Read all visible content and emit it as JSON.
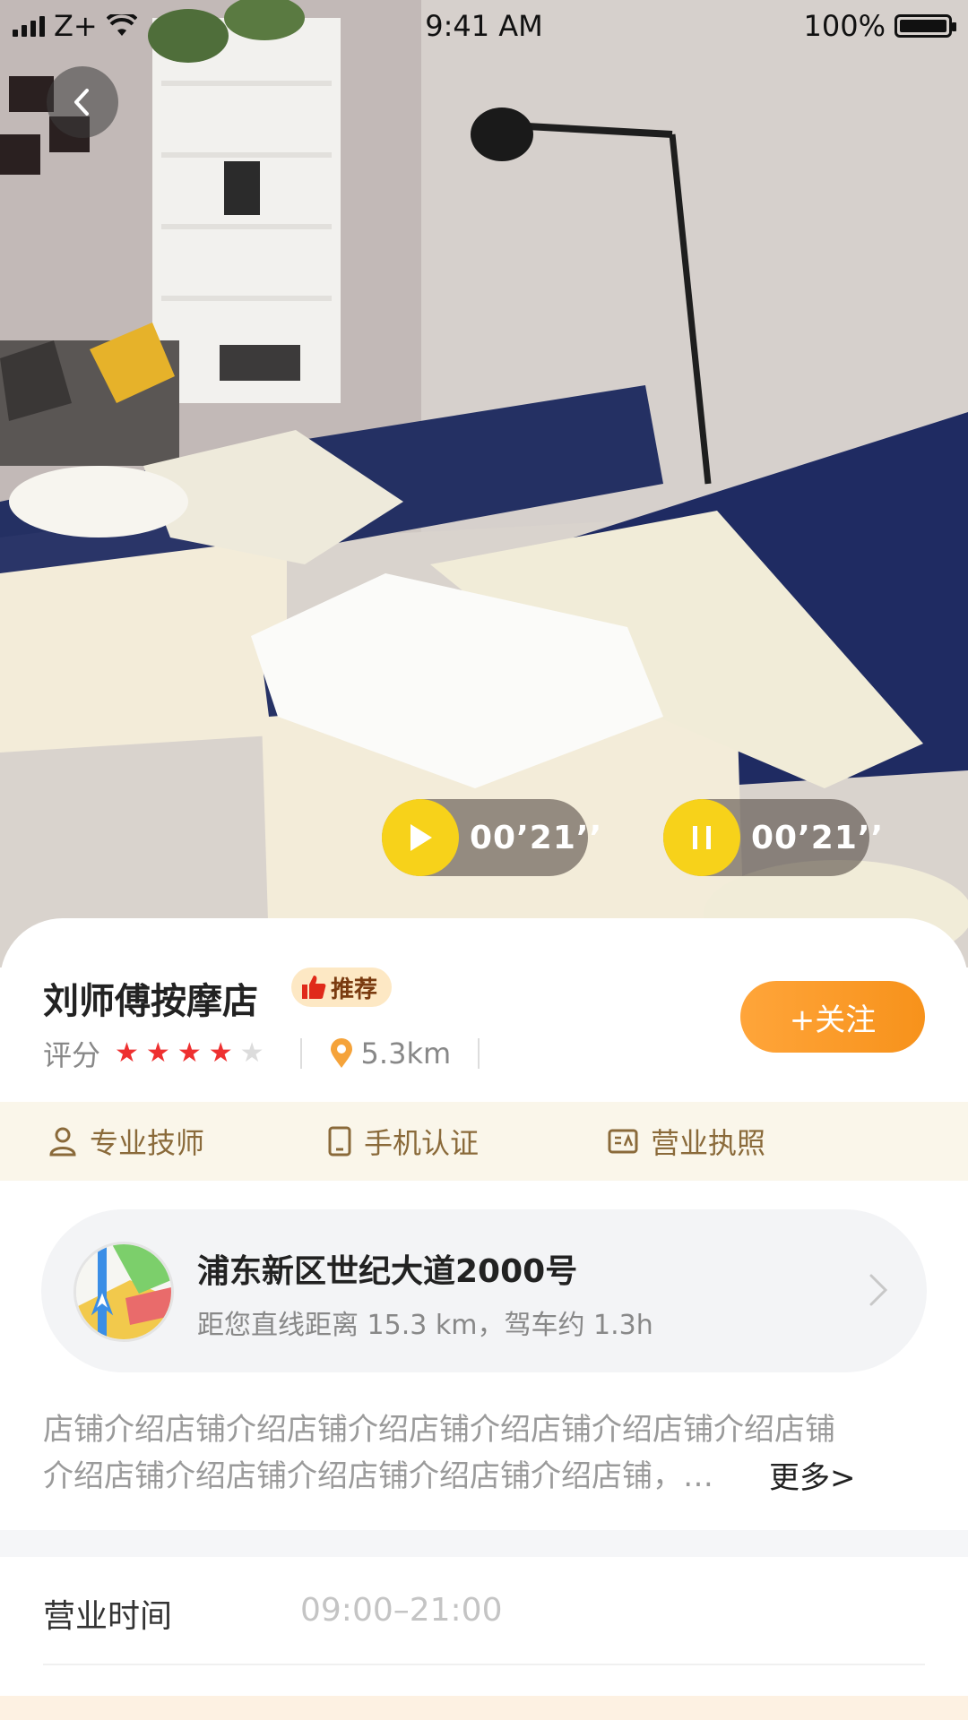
{
  "status_bar": {
    "carrier": "Z+",
    "time": "9:41 AM",
    "battery": "100%"
  },
  "audio": [
    {
      "duration": "00’21’’",
      "state": "play"
    },
    {
      "duration": "00’21’’",
      "state": "pause"
    }
  ],
  "shop": {
    "name": "刘师傅按摩店",
    "badge": "推荐",
    "rating_label": "评分",
    "rating": 4,
    "rating_max": 5,
    "distance": "5.3km",
    "follow_label": "+关注"
  },
  "certifications": [
    {
      "label": "专业技师",
      "icon": "person-icon"
    },
    {
      "label": "手机认证",
      "icon": "phone-icon"
    },
    {
      "label": "营业执照",
      "icon": "license-icon"
    }
  ],
  "address": {
    "title": "浦东新区世纪大道2000号",
    "subtitle": "距您直线距离 15.3 km，驾车约 1.3h"
  },
  "intro": {
    "line1": "店铺介绍店铺介绍店铺介绍店铺介绍店铺介绍店铺介绍店铺",
    "line2": "介绍店铺介绍店铺介绍店铺介绍店铺介绍店铺，…",
    "more_label": "更多>"
  },
  "hours": {
    "label": "营业时间",
    "value": "09:00–21:00"
  },
  "colors": {
    "accent_orange": "#f7921b",
    "star_red": "#ee3030",
    "audio_yellow": "#f7d21a",
    "cert_text": "#8a6a3a"
  }
}
